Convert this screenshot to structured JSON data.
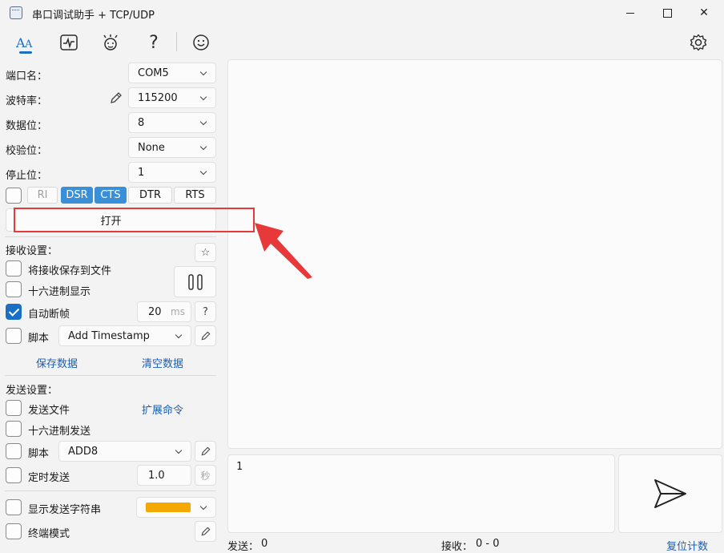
{
  "window": {
    "title": "串口调试助手 + TCP/UDP",
    "icon": "serial-port-app-icon"
  },
  "toolbar": {
    "items": [
      {
        "name": "font-icon",
        "glyph": "A"
      },
      {
        "name": "waveform-icon",
        "glyph": "〜"
      },
      {
        "name": "plugin-icon",
        "glyph": "✿"
      },
      {
        "name": "help-icon",
        "glyph": "?"
      },
      {
        "name": "smiley-icon",
        "glyph": "☺"
      }
    ],
    "settings_icon": "⚙"
  },
  "serial": {
    "port_label": "端口名：",
    "port_value": "COM5",
    "baud_label": "波特率：",
    "baud_value": "115200",
    "databits_label": "数据位：",
    "databits_value": "8",
    "parity_label": "校验位：",
    "parity_value": "None",
    "stopbits_label": "停止位：",
    "stopbits_value": "1",
    "signals": {
      "ri": "RI",
      "dsr": "DSR",
      "cts": "CTS",
      "dtr": "DTR",
      "rts": "RTS"
    },
    "open_button": "打开"
  },
  "receive": {
    "title": "接收设置：",
    "save_to_file": "将接收保存到文件",
    "hex_display": "十六进制显示",
    "auto_frame": "自动断帧",
    "frame_ms_value": "20",
    "frame_ms_unit": "ms",
    "frame_help": "?",
    "script_label": "脚本",
    "script_value": "Add Timestamp",
    "save_data": "保存数据",
    "clear_data": "清空数据"
  },
  "send": {
    "title": "发送设置：",
    "send_file": "发送文件",
    "ext_command": "扩展命令",
    "hex_send": "十六进制发送",
    "script_label": "脚本",
    "script_value": "ADD8",
    "timed_send": "定时发送",
    "timed_value": "1.0",
    "timed_unit": "秒",
    "show_send_str": "显示发送字符串",
    "terminal_mode": "终端模式",
    "color_swatch": "#f5a800"
  },
  "send_text": "1",
  "status": {
    "sent_label": "发送：",
    "sent_value": "0",
    "recv_label": "接收：",
    "recv_value": "0 - 0",
    "reset_count": "复位计数"
  }
}
